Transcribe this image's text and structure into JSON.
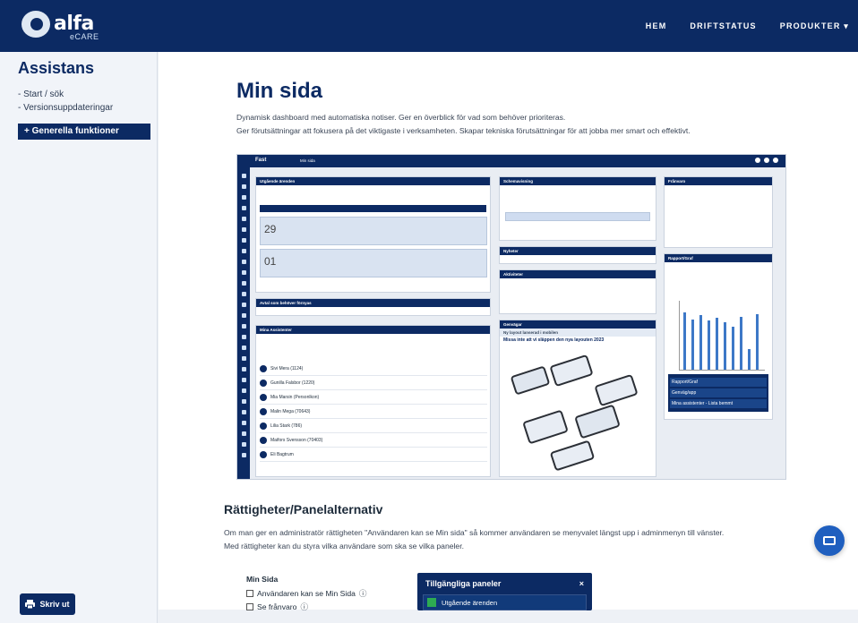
{
  "brand": {
    "name": "alfa",
    "sub": "eCARE"
  },
  "nav": {
    "home": "HEM",
    "status": "DRIFTSTATUS",
    "products": "PRODUKTER ▾"
  },
  "sidebar": {
    "title": "Assistans",
    "links": [
      "- Start / sök",
      "- Versionsuppdateringar"
    ],
    "button": "+ Generella funktioner",
    "print": "Skriv ut"
  },
  "main": {
    "title": "Min sida",
    "intro": [
      "Dynamisk dashboard med automatiska notiser. Ger en överblick för vad som behöver prioriteras.",
      "Ger förutsättningar att fokusera på det viktigaste i verksamheten. Skapar tekniska förutsättningar för att jobba mer smart och effektivt."
    ],
    "section_title": "Rättigheter/Panelalternativ",
    "section_text": [
      "Om man ger en administratör rättigheten \"Användaren kan se Min sida\" så kommer användaren se menyvalet längst upp i adminmenyn till vänster.",
      "Med rättigheter kan du styra vilka användare som ska se vilka paneler."
    ],
    "perm_title": "Min Sida",
    "perm_items": [
      "Användaren kan se Min Sida",
      "Se frånvaro"
    ],
    "panel_title": "Tillgängliga paneler",
    "panel_close": "×",
    "panel_item": "Utgående ärenden"
  },
  "dashboard": {
    "app": "Fast",
    "page": "Min sida",
    "cards": {
      "outgoing": "Utgående ärenden",
      "schedule": "Schemavisning",
      "absence": "Frånvaro",
      "assistants": "Mina Assistenter",
      "reports": "Rapport/Graf",
      "notes": "Nyheter",
      "tasks": "Aktiviteter",
      "shortcuts": "Genvägar",
      "prio": "Avtal som behöver förnyas"
    },
    "dates": [
      "29",
      "01"
    ],
    "news_heading": "Ny layout lanserad i mobilen",
    "news_sub": "Missa inte att vi släppen den nya layouten 2023",
    "side_list": [
      "Rapport/Graf",
      "Genväg/app",
      "Mina assistenter - Lista bemmt"
    ],
    "assistants": [
      "Sivi Mera (1124)",
      "Gunilla Falsbor (1220)",
      "Mia Marsin (Personlkon)",
      "Malin Mega (70643)",
      "Lilia Stark (786)",
      "Maifors Svensson (70403)",
      "Eli Bagtrum"
    ],
    "bars": [
      0.82,
      0.72,
      0.78,
      0.7,
      0.74,
      0.68,
      0.62,
      0.76,
      0.3,
      0.8
    ]
  }
}
